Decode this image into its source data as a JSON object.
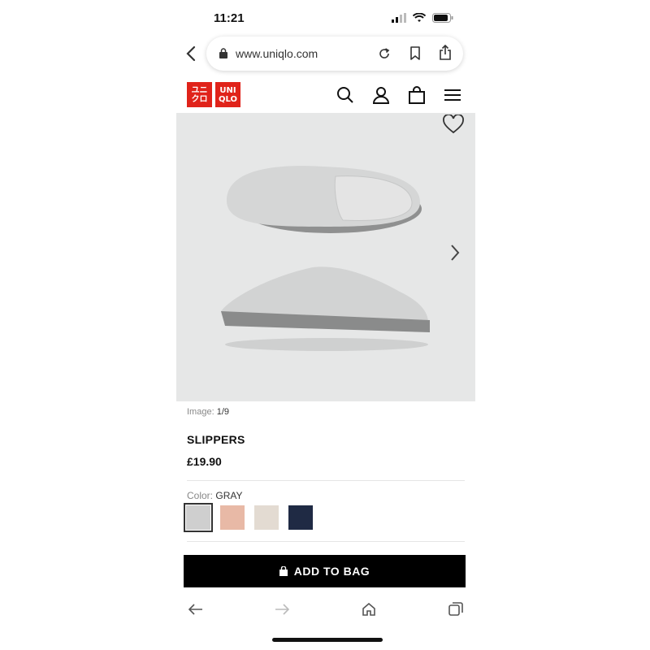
{
  "status_bar": {
    "time": "11:21"
  },
  "browser": {
    "url": "www.uniqlo.com"
  },
  "logo": {
    "line1_a": "ユニ",
    "line2_a": "クロ",
    "line1_b": "UNI",
    "line2_b": "QLO",
    "color": "#e0231a"
  },
  "product": {
    "image_counter_label": "Image:",
    "image_counter_value": "1/9",
    "name": "SLIPPERS",
    "price": "£19.90",
    "color_label": "Color:",
    "color_value": "GRAY",
    "swatches": [
      {
        "name": "gray",
        "color": "#cfcfcf",
        "selected": true
      },
      {
        "name": "pink",
        "color": "#e8b9a6",
        "selected": false
      },
      {
        "name": "beige",
        "color": "#e3dbd2",
        "selected": false
      },
      {
        "name": "navy",
        "color": "#1f2a44",
        "selected": false
      }
    ]
  },
  "actions": {
    "add_to_bag": "ADD TO BAG"
  },
  "icons": [
    "back-icon",
    "lock-icon",
    "reload-icon",
    "bookmark-icon",
    "share-icon",
    "search-icon",
    "account-icon",
    "bag-icon",
    "menu-icon",
    "heart-icon",
    "chevron-right-icon",
    "home-icon",
    "tabs-icon"
  ]
}
